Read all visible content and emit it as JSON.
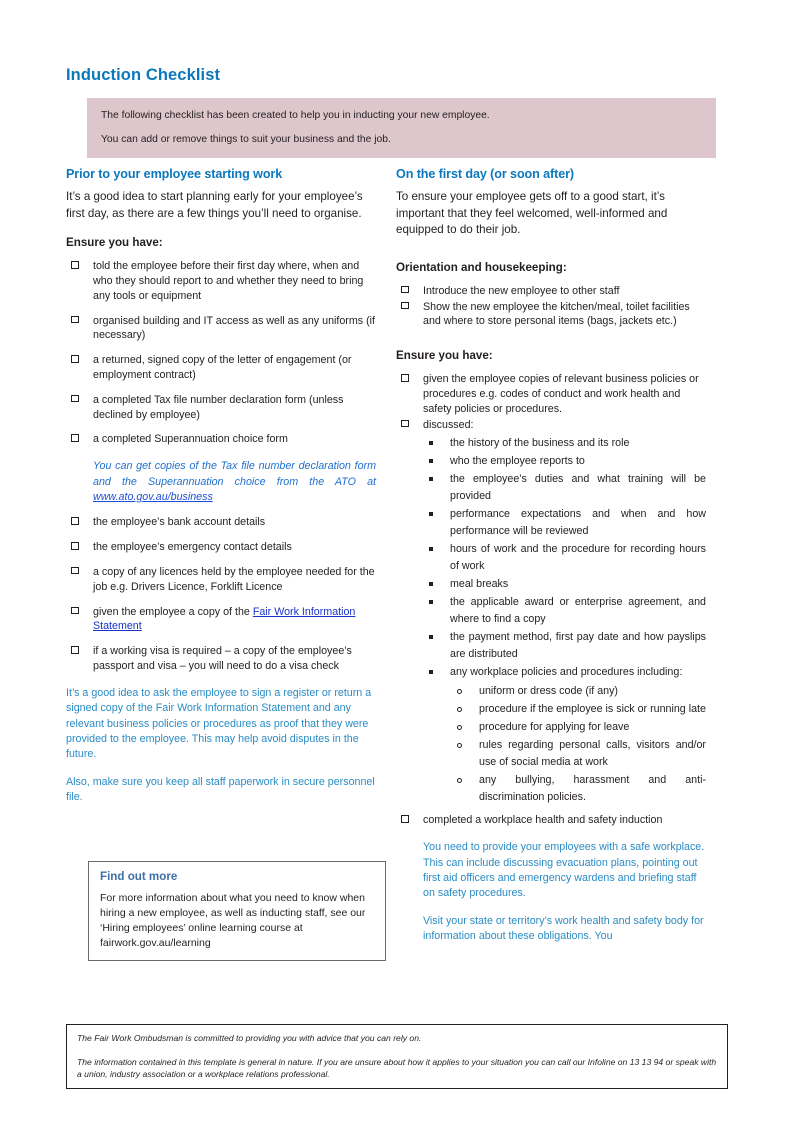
{
  "document": {
    "title": "Induction Checklist",
    "banner": [
      "The following checklist has been created to help you in inducting your new employee.",
      "You can add or remove things to suit your business and the job."
    ]
  },
  "colors": {
    "title_blue": "#0c78bc",
    "banner_pink": "#ddc6cc",
    "advisory_blue": "#2b8cc4",
    "link_blue": "#1a33c8",
    "findbox_title_blue": "#3f6fa8",
    "body_text": "#231f20"
  },
  "left_column": {
    "heading": "Prior to your employee starting work",
    "intro": "It’s a good idea to start planning early for your employee’s first day, as there are a few things you’ll need to organise.",
    "sub_heading": "Ensure you have:",
    "items_part1": [
      "told the employee before their first day where, when and who they should report to and whether they need to bring any tools or equipment",
      "organised building and IT access as well as any uniforms (if necessary)",
      "a returned, signed copy of the letter of engagement (or employment contract)",
      "a completed Tax file number declaration form (unless declined by employee)",
      "a completed Superannuation choice form"
    ],
    "ato_note": {
      "text_before": "You can get copies of the Tax file number declaration form and the Superannuation choice from the ATO at ",
      "link_text": "www.ato.gov.au/business"
    },
    "items_part2": [
      "the employee’s bank account details",
      "the employee’s emergency contact details",
      "a copy of any licences held by the employee needed for the job e.g. Drivers Licence, Forklift Licence"
    ],
    "fwis_item": {
      "text_before": "given the employee a copy of the ",
      "link_text": "Fair Work Information Statement"
    },
    "items_part3": [
      "if a working visa is required – a copy of the employee’s passport and visa – you will need to do a visa check"
    ],
    "advisories": [
      "It’s a good idea to ask the employee to sign a register or return a signed copy of the Fair Work Information Statement and any relevant business policies or procedures as proof that they were provided to the employee.  This may help avoid disputes in the future.",
      "Also, make sure you keep all staff paperwork in secure personnel file."
    ],
    "find_out_more": {
      "title": "Find out more",
      "body": "For more information about what you need to know when hiring a new employee, as well as inducting staff, see our ‘Hiring employees’ online learning course at fairwork.gov.au/learning"
    }
  },
  "right_column": {
    "heading": "On the first day (or soon after)",
    "intro": "To ensure your employee gets off to a good start, it’s important that they feel welcomed, well-informed and equipped to do their job.",
    "orientation_heading": "Orientation and housekeeping:",
    "orientation_items": [
      "Introduce the new employee to other staff",
      "Show the new employee the kitchen/meal, toilet facilities and where to store personal items (bags, jackets etc.)"
    ],
    "ensure_heading": "Ensure you have:",
    "ensure_items": [
      "given the employee copies of relevant business policies or procedures  e.g. codes of conduct and work health and safety policies or procedures.",
      "discussed:"
    ],
    "discussed_bullets": [
      "the history of the business and its role",
      "who the employee reports to",
      "the employee’s duties and what training will be provided",
      "performance expectations and when and how performance will be reviewed",
      "hours of work and the procedure for recording hours of work",
      "meal breaks",
      "the applicable award or enterprise agreement, and where to find a copy",
      "the payment method, first pay date and how payslips are distributed",
      "any workplace policies and procedures including:"
    ],
    "policy_sub_bullets": [
      "uniform or dress code (if any)",
      "procedure if the employee is sick or running late",
      "procedure for applying for leave",
      "rules regarding personal calls, visitors and/or use of social media at work",
      "any bullying, harassment and anti-discrimination policies."
    ],
    "whs_item": "completed a workplace health and safety induction",
    "whs_advisories": [
      "You need to provide your employees with a safe workplace. This can include discussing evacuation plans, pointing out first aid officers and emergency wardens and briefing staff on safety procedures.",
      "Visit your state or territory’s work health and safety body for information about these obligations. You"
    ]
  },
  "footer": {
    "line1": "The Fair Work Ombudsman is committed to providing you with advice that you can rely on.",
    "line2": "The information contained in this template is general in nature. If you are unsure about how it applies to your situation you can call our Infoline on 13 13 94 or speak with a union, industry association or a workplace relations professional."
  }
}
